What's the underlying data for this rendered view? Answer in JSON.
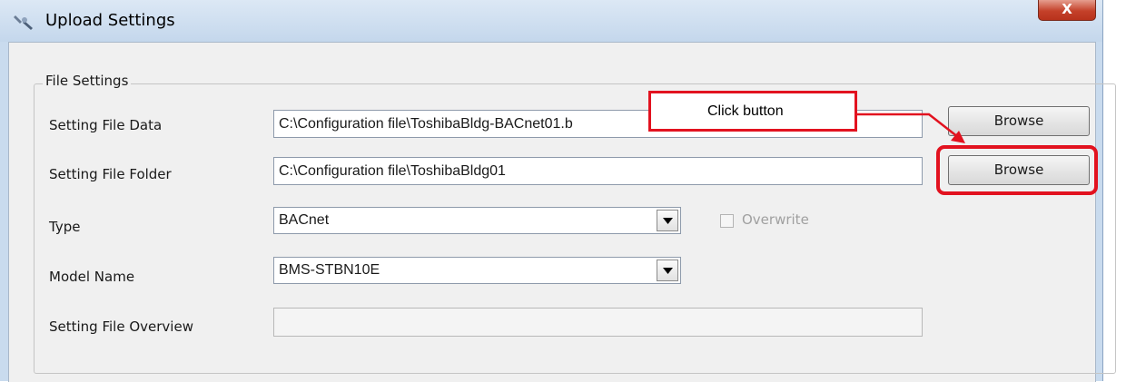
{
  "window": {
    "title": "Upload Settings",
    "close_label": "X"
  },
  "file_settings": {
    "group_title": "File Settings",
    "setting_file_data": {
      "label": "Setting File Data",
      "value": "C:\\Configuration file\\ToshibaBldg-BACnet01.b",
      "button_label": "Browse"
    },
    "setting_file_folder": {
      "label": "Setting File Folder",
      "value": "C:\\Configuration file\\ToshibaBldg01",
      "button_label": "Browse"
    },
    "type": {
      "label": "Type",
      "selected": "BACnet"
    },
    "overwrite": {
      "label": "Overwrite",
      "checked": false,
      "enabled": false
    },
    "model_name": {
      "label": "Model Name",
      "selected": "BMS-STBN10E"
    },
    "overview": {
      "label": "Setting File Overview",
      "value": ""
    }
  },
  "annotation": {
    "callout_text": "Click button",
    "color": "#e2121f"
  }
}
